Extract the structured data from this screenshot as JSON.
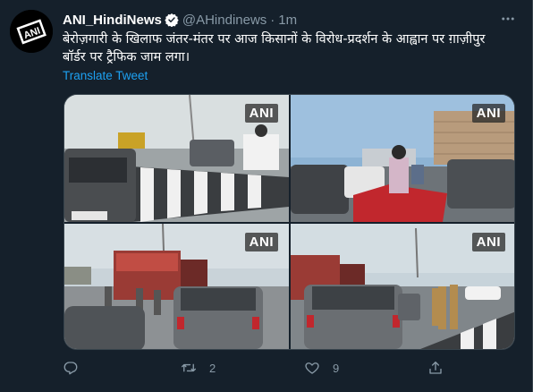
{
  "tweet": {
    "author_name": "ANI_HindiNews",
    "handle": "@AHindinews",
    "separator": "·",
    "time": "1m",
    "text": "बेरोज़गारी के खिलाफ जंतर-मंतर पर आज किसानों के विरोध-प्रदर्शन के आह्वान पर ग़ाज़ीपुर बॉर्डर पर ट्रैफिक जाम लगा।",
    "translate_label": "Translate Tweet",
    "avatar_logo_text": "ANI"
  },
  "media": {
    "photos": [
      {
        "watermark": "ANI",
        "icon": "traffic-photo-icon"
      },
      {
        "watermark": "ANI",
        "icon": "traffic-photo-icon"
      },
      {
        "watermark": "ANI",
        "icon": "traffic-photo-icon"
      },
      {
        "watermark": "ANI",
        "icon": "traffic-photo-icon"
      }
    ]
  },
  "actions": {
    "reply_count": "",
    "retweet_count": "2",
    "like_count": "9",
    "share_count": ""
  },
  "colors": {
    "background": "#15202b",
    "secondary_text": "#8899a6",
    "link": "#1da1f2",
    "verified_badge": "#ffffff"
  }
}
